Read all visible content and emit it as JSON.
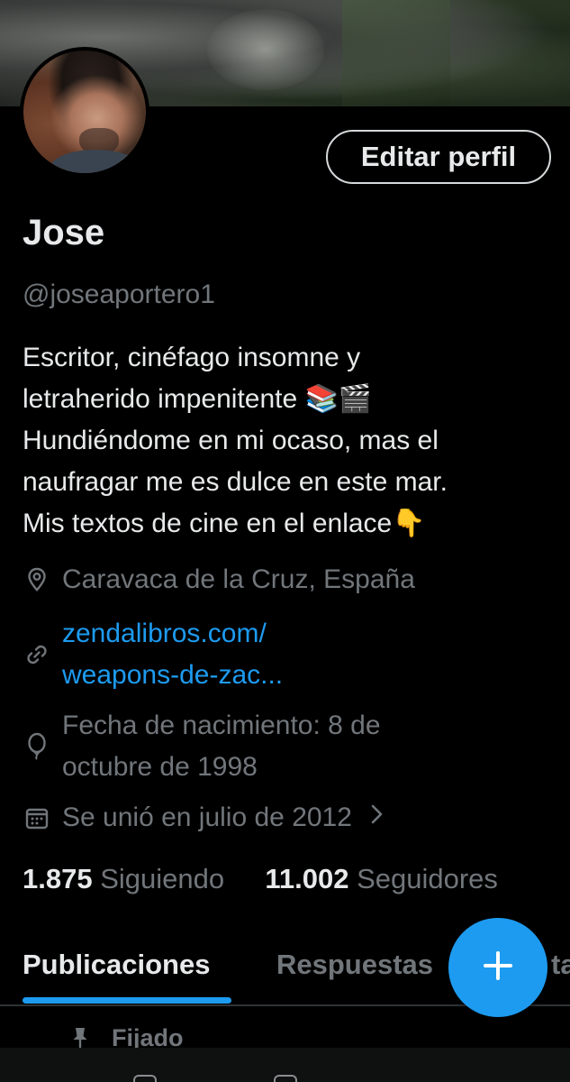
{
  "profile": {
    "name": "Jose",
    "handle": "@joseaportero1",
    "edit_button": "Editar perfil",
    "bio_lines": [
      "Escritor, cinéfago insomne y",
      "letraherido impenitente 📚🎬",
      "Hundiéndome en mi ocaso, mas el",
      "naufragar me es dulce en este mar.",
      "Mis textos de cine en el enlace👇"
    ],
    "location": "Caravaca de la Cruz, España",
    "link_line1": "zendalibros.com/",
    "link_line2": "weapons-de-zac...",
    "birthday_line1": "Fecha de nacimiento: 8 de",
    "birthday_line2": "octubre de 1998",
    "joined": "Se unió en julio de 2012"
  },
  "stats": {
    "following_count": "1.875",
    "following_label": "Siguiendo",
    "followers_count": "11.002",
    "followers_label": "Seguidores"
  },
  "tabs": [
    {
      "label": "Publicaciones",
      "active": true
    },
    {
      "label": "Respuestas",
      "active": false
    },
    {
      "label": "ta",
      "active": false
    }
  ],
  "pinned_label": "Fijado",
  "icons": {
    "location": "location-pin-icon",
    "link": "link-icon",
    "birthday": "balloon-icon",
    "joined": "calendar-icon",
    "chevron": "chevron-right-icon",
    "fab": "plus-icon",
    "pinned": "pin-icon"
  },
  "colors": {
    "background": "#000000",
    "text": "#e7e9ea",
    "secondary": "#71767b",
    "accent": "#1d9bf0",
    "divider": "#2f3336"
  }
}
